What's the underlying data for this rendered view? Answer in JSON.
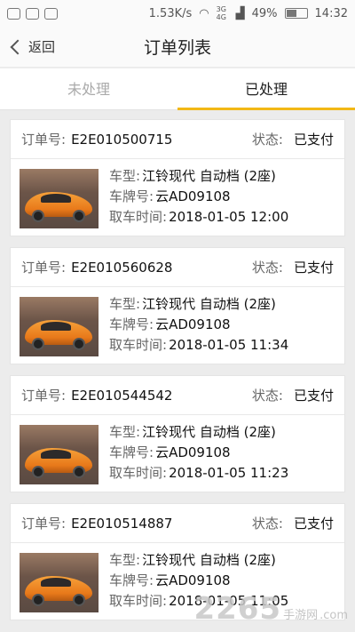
{
  "status_bar": {
    "speed": "1.53K/s",
    "network_label": "3G 4G",
    "battery": "49%",
    "battery_level": 0.49,
    "time": "14:32"
  },
  "nav": {
    "back_label": "返回",
    "title": "订单列表"
  },
  "tabs": [
    {
      "label": "未处理",
      "active": false
    },
    {
      "label": "已处理",
      "active": true
    }
  ],
  "field_labels": {
    "order_no": "订单号:",
    "status": "状态:",
    "car_type": "车型:",
    "plate": "车牌号:",
    "pickup_time": "取车时间:"
  },
  "orders": [
    {
      "order_no": "E2E010500715",
      "status": "已支付",
      "car_type": "江铃现代 自动档 (2座)",
      "plate": "云AD09108",
      "pickup_time": "2018-01-05 12:00"
    },
    {
      "order_no": "E2E010560628",
      "status": "已支付",
      "car_type": "江铃现代 自动档 (2座)",
      "plate": "云AD09108",
      "pickup_time": "2018-01-05 11:34"
    },
    {
      "order_no": "E2E010544542",
      "status": "已支付",
      "car_type": "江铃现代 自动档 (2座)",
      "plate": "云AD09108",
      "pickup_time": "2018-01-05 11:23"
    },
    {
      "order_no": "E2E010514887",
      "status": "已支付",
      "car_type": "江铃现代 自动档 (2座)",
      "plate": "云AD09108",
      "pickup_time": "2018-01-05 11:05"
    }
  ],
  "watermark": {
    "number": "2265",
    "suffix": "手游网",
    "domain": ".com"
  },
  "colors": {
    "accent": "#f2b816",
    "background": "#ececec"
  }
}
